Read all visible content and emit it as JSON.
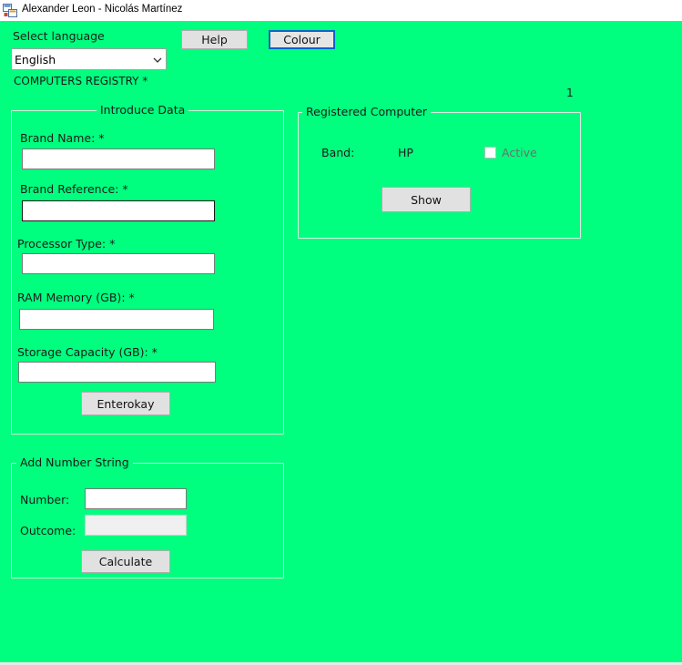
{
  "window": {
    "title": "Alexander Leon - Nicolás Martínez",
    "icon": "app-form-icon"
  },
  "top": {
    "select_language_label": "Select language",
    "language_selected": "English",
    "help_label": "Help",
    "colour_label": "Colour",
    "registry_title": "COMPUTERS REGISTRY *",
    "counter": "1"
  },
  "introduce_data": {
    "legend": "Introduce Data",
    "fields": [
      {
        "label": "Brand Name: *",
        "value": ""
      },
      {
        "label": "Brand Reference: *",
        "value": ""
      },
      {
        "label": "Processor Type: *",
        "value": ""
      },
      {
        "label": "RAM Memory (GB): *",
        "value": ""
      },
      {
        "label": "Storage Capacity (GB): *",
        "value": ""
      }
    ],
    "button_label": "Enterokay"
  },
  "add_number": {
    "legend": "Add Number String",
    "number_label": "Number:",
    "number_value": "",
    "outcome_label": "Outcome:",
    "outcome_value": "",
    "button_label": "Calculate"
  },
  "registered": {
    "legend": "Registered Computer",
    "band_label": "Band:",
    "band_value": "HP",
    "active_label": "Active",
    "active_checked": false,
    "button_label": "Show"
  },
  "colors": {
    "background": "#00ff7f",
    "focus_border": "#0a63c9"
  }
}
